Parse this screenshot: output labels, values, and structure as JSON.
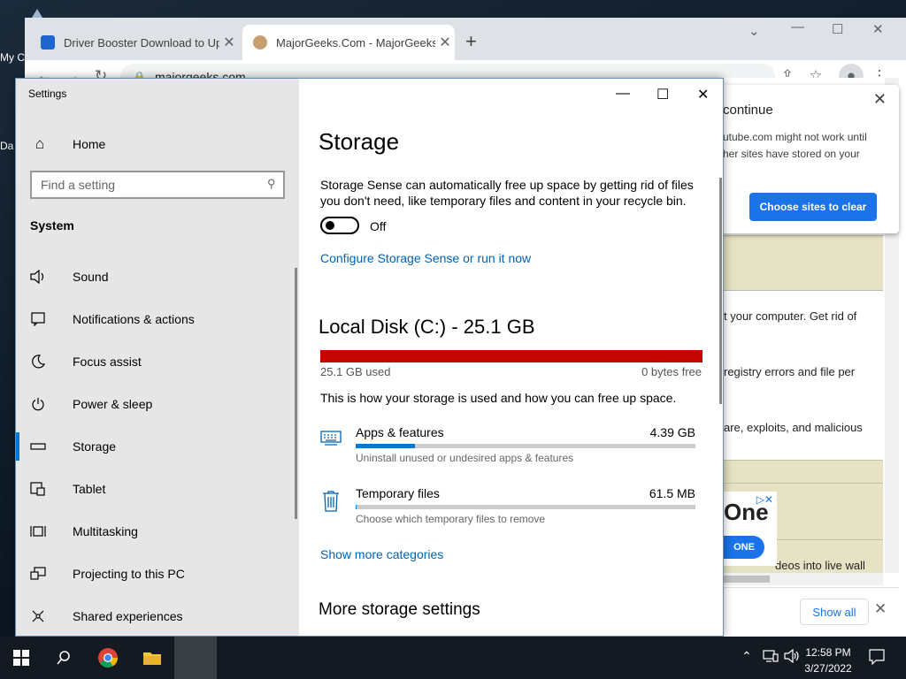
{
  "desktop": {
    "icons": [
      {
        "label": "My C"
      },
      {
        "label": "Da"
      }
    ]
  },
  "browser": {
    "tabs": [
      {
        "label": "Driver Booster Download to Upd",
        "favicon_color": "#1e66d0"
      },
      {
        "label": "MajorGeeks.Com - MajorGeeks",
        "favicon_color": "#c8a070"
      }
    ],
    "url": "majorgeeks.com",
    "popup": {
      "title": "continue",
      "body": "utube.com might not work until her sites have stored on your",
      "button": "Choose sites to clear"
    },
    "page_lines": [
      "t your computer. Get rid of",
      "registry errors and file per",
      "are, exploits, and malicious",
      "deos into live wall"
    ],
    "ad": {
      "text": "One",
      "button": "ONE"
    },
    "download_bar": {
      "show_all": "Show all"
    }
  },
  "settings": {
    "window_title": "Settings",
    "home": "Home",
    "search_placeholder": "Find a setting",
    "section": "System",
    "nav": [
      {
        "label": "Sound",
        "icon": "speaker-icon"
      },
      {
        "label": "Notifications & actions",
        "icon": "notification-icon"
      },
      {
        "label": "Focus assist",
        "icon": "moon-icon"
      },
      {
        "label": "Power & sleep",
        "icon": "power-icon"
      },
      {
        "label": "Storage",
        "icon": "storage-icon",
        "active": true
      },
      {
        "label": "Tablet",
        "icon": "tablet-icon"
      },
      {
        "label": "Multitasking",
        "icon": "multitasking-icon"
      },
      {
        "label": "Projecting to this PC",
        "icon": "projecting-icon"
      },
      {
        "label": "Shared experiences",
        "icon": "shared-icon"
      }
    ],
    "content": {
      "title": "Storage",
      "description": "Storage Sense can automatically free up space by getting rid of files you don't need, like temporary files and content in your recycle bin.",
      "toggle_state": "Off",
      "configure_link": "Configure Storage Sense or run it now",
      "disk_title": "Local Disk (C:) - 25.1 GB",
      "disk_used_fraction": 1.0,
      "disk_used": "25.1 GB used",
      "disk_free": "0 bytes free",
      "howto": "This is how your storage is used and how you can free up space.",
      "categories": [
        {
          "name": "Apps & features",
          "size": "4.39 GB",
          "sub": "Uninstall unused or undesired apps & features",
          "fraction": 0.175,
          "icon": "keyboard-icon"
        },
        {
          "name": "Temporary files",
          "size": "61.5 MB",
          "sub": "Choose which temporary files to remove",
          "fraction": 0.0025,
          "icon": "trash-icon"
        }
      ],
      "show_more": "Show more categories",
      "more_title": "More storage settings"
    }
  },
  "taskbar": {
    "time": "12:58 PM",
    "date": "3/27/2022"
  }
}
